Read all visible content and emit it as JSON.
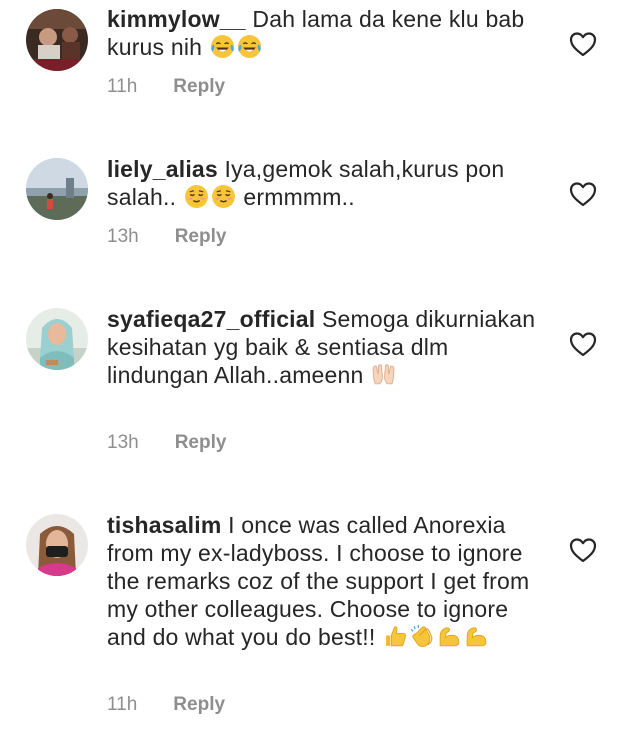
{
  "comments": [
    {
      "username": "kimmylow__",
      "text_before": " Dah lama da kene klu bab kurus nih ",
      "text_after": "",
      "emojis": [
        "face-with-tears-of-joy-icon",
        "face-with-tears-of-joy-icon"
      ],
      "time": "11h",
      "reply": "Reply"
    },
    {
      "username": "liely_alias",
      "text_before": " Iya,gemok salah,kurus pon salah.. ",
      "text_after": " ermmmm..",
      "emojis": [
        "relieved-face-icon",
        "relieved-face-icon"
      ],
      "time": "13h",
      "reply": "Reply"
    },
    {
      "username": "syafieqa27_official",
      "text_before": " Semoga dikurniakan kesihatan yg baik & sentiasa dlm lindungan Allah..ameenn ",
      "text_after": "",
      "emojis": [
        "palms-up-together-icon"
      ],
      "time": "13h",
      "reply": "Reply"
    },
    {
      "username": "tishasalim",
      "text_before": " I once was called Anorexia from my ex-ladyboss. I choose to ignore the remarks coz of the support I get from my other colleagues. Choose to ignore and do what you do best!! ",
      "text_after": "",
      "emojis": [
        "thumbs-up-icon",
        "clapping-hands-icon",
        "flexed-biceps-icon",
        "flexed-biceps-icon"
      ],
      "time": "11h",
      "reply": "Reply"
    }
  ],
  "colors": {
    "text": "#262626",
    "secondary": "#8e8e8e",
    "background": "#ffffff"
  }
}
